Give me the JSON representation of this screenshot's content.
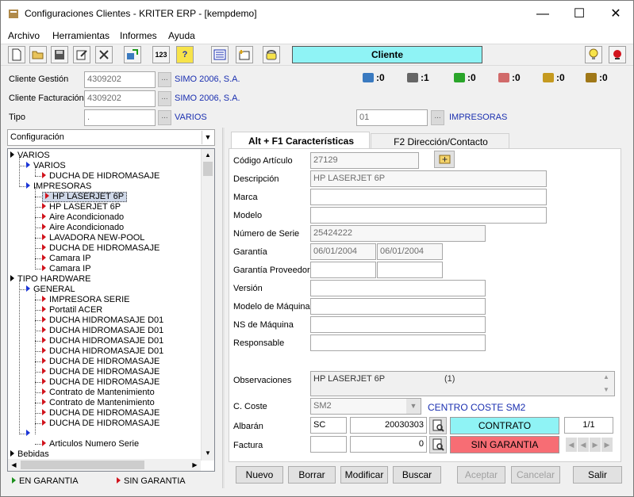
{
  "window": {
    "title": "Configuraciones Clientes - KRITER ERP - [kempdemo]",
    "min_label": "—",
    "max_label": "☐",
    "close_label": "✕"
  },
  "menu": [
    "Archivo",
    "Herramientas",
    "Informes",
    "Ayuda"
  ],
  "toolbar": {
    "center_label": "Cliente",
    "center_color": "#8ff3f5",
    "btn_123": "123",
    "btn_help": "?"
  },
  "header": {
    "cliente_gestion_label": "Cliente Gestión",
    "cliente_gestion_value": "4309202",
    "cliente_gestion_name": "SIMO 2006, S.A.",
    "cliente_facturacion_label": "Cliente Facturación",
    "cliente_facturacion_value": "4309202",
    "cliente_facturacion_name": "SIMO 2006, S.A.",
    "tipo_label": "Tipo",
    "tipo_value": ".",
    "tipo_name": "VARIOS",
    "tipo2_value": "01",
    "tipo2_name": "IMPRESORAS"
  },
  "stats": [
    ":0",
    ":1",
    ":0",
    ":0",
    ":0",
    ":0"
  ],
  "left": {
    "combo_value": "Configuración",
    "tree": [
      {
        "text": "VARIOS",
        "indent": 0,
        "color": "black"
      },
      {
        "text": "VARIOS",
        "indent": 1,
        "color": "blue"
      },
      {
        "text": "DUCHA DE HIDROMASAJE",
        "indent": 2,
        "color": "red"
      },
      {
        "text": "IMPRESORAS",
        "indent": 1,
        "color": "blue"
      },
      {
        "text": "HP LASERJET 6P",
        "indent": 2,
        "color": "red",
        "selected": true
      },
      {
        "text": "HP LASERJET 6P",
        "indent": 2,
        "color": "red"
      },
      {
        "text": "Aire Acondicionado",
        "indent": 2,
        "color": "red"
      },
      {
        "text": "Aire Acondicionado",
        "indent": 2,
        "color": "red"
      },
      {
        "text": "LAVADORA NEW-POOL",
        "indent": 2,
        "color": "red"
      },
      {
        "text": "DUCHA DE HIDROMASAJE",
        "indent": 2,
        "color": "red"
      },
      {
        "text": "Camara IP",
        "indent": 2,
        "color": "red"
      },
      {
        "text": "Camara IP",
        "indent": 2,
        "color": "red"
      },
      {
        "text": "TIPO HARDWARE",
        "indent": 0,
        "color": "black"
      },
      {
        "text": "GENERAL",
        "indent": 1,
        "color": "blue"
      },
      {
        "text": "IMPRESORA SERIE",
        "indent": 2,
        "color": "red"
      },
      {
        "text": "Portatil ACER",
        "indent": 2,
        "color": "red"
      },
      {
        "text": "DUCHA HIDROMASAJE D01",
        "indent": 2,
        "color": "red"
      },
      {
        "text": "DUCHA HIDROMASAJE D01",
        "indent": 2,
        "color": "red"
      },
      {
        "text": "DUCHA HIDROMASAJE D01",
        "indent": 2,
        "color": "red"
      },
      {
        "text": "DUCHA HIDROMASAJE D01",
        "indent": 2,
        "color": "red"
      },
      {
        "text": "DUCHA DE HIDROMASAJE",
        "indent": 2,
        "color": "red"
      },
      {
        "text": "DUCHA DE HIDROMASAJE",
        "indent": 2,
        "color": "red"
      },
      {
        "text": "DUCHA DE HIDROMASAJE",
        "indent": 2,
        "color": "red"
      },
      {
        "text": "Contrato de Mantenimiento",
        "indent": 2,
        "color": "red"
      },
      {
        "text": "Contrato de Mantenimiento",
        "indent": 2,
        "color": "red"
      },
      {
        "text": "DUCHA DE HIDROMASAJE",
        "indent": 2,
        "color": "red"
      },
      {
        "text": "DUCHA DE HIDROMASAJE",
        "indent": 2,
        "color": "red"
      },
      {
        "text": "",
        "indent": 1,
        "color": "blue"
      },
      {
        "text": "Articulos Numero Serie",
        "indent": 2,
        "color": "red"
      },
      {
        "text": "Bebidas",
        "indent": 0,
        "color": "black"
      }
    ],
    "legend_garantia": "EN GARANTIA",
    "legend_sin_garantia": "SIN GARANTIA"
  },
  "tabs": {
    "tab1": "Alt + F1 Características",
    "tab2": "F2 Dirección/Contacto"
  },
  "form": {
    "codigo_label": "Código Artículo",
    "codigo_value": "27129",
    "descripcion_label": "Descripción",
    "descripcion_value": "HP LASERJET 6P",
    "marca_label": "Marca",
    "modelo_label": "Modelo",
    "serie_label": "Número de Serie",
    "serie_value": "25424222",
    "garantia_label": "Garantía",
    "garantia_from": "06/01/2004",
    "garantia_to": "06/01/2004",
    "garantia_prov_label": "Garantía Proveedor",
    "version_label": "Versión",
    "modelo_maquina_label": "Modelo de Máquina",
    "ns_maquina_label": "NS de Máquina",
    "responsable_label": "Responsable",
    "observaciones_label": "Observaciones",
    "observaciones_value": "HP LASERJET 6P",
    "observaciones_count": "(1)",
    "coste_label": "C. Coste",
    "coste_value": "SM2",
    "coste_name": "CENTRO COSTE SM2",
    "albaran_label": "Albarán",
    "albaran_serie": "SC",
    "albaran_num": "20030303",
    "contrato_label": "CONTRATO",
    "contrato_color": "#8ff3f5",
    "page_count": "1/1",
    "factura_label": "Factura",
    "factura_num": "0",
    "sin_garantia_label": "SIN GARANTIA",
    "sin_garantia_color": "#f76d74"
  },
  "buttons": {
    "nuevo": "Nuevo",
    "borrar": "Borrar",
    "modificar": "Modificar",
    "buscar": "Buscar",
    "aceptar": "Aceptar",
    "cancelar": "Cancelar",
    "salir": "Salir"
  }
}
